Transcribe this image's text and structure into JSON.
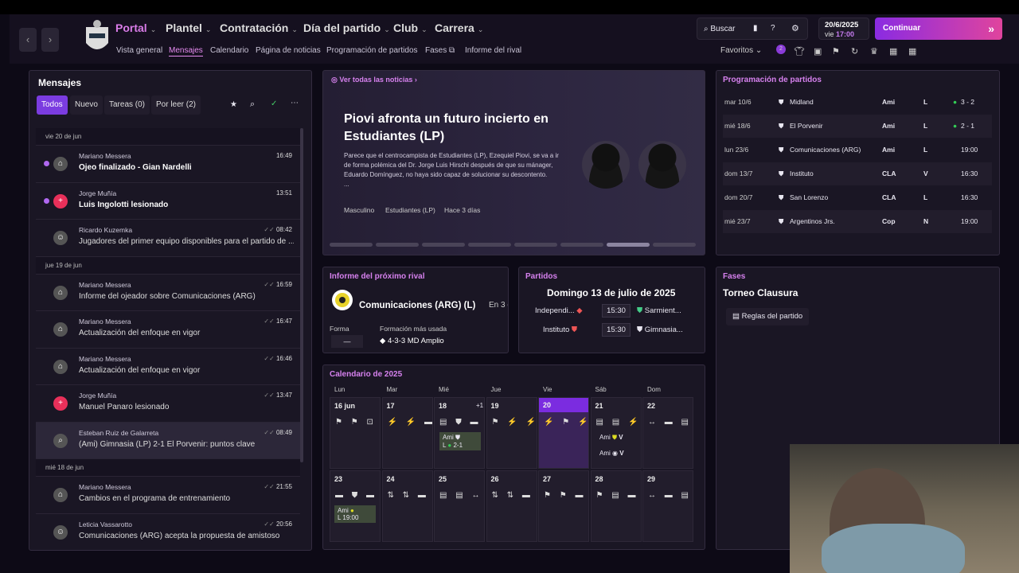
{
  "nav": {
    "main": [
      "Portal",
      "Plantel",
      "Contratación",
      "Día del partido",
      "Club",
      "Carrera"
    ],
    "sub": [
      "Vista general",
      "Mensajes",
      "Calendario",
      "Página de noticias",
      "Programación de partidos",
      "Fases",
      "Informe del rival"
    ],
    "search": "Buscar",
    "date": "20/6/2025",
    "day": "vie",
    "time": "17:00",
    "continue": "Continuar",
    "favorites": "Favoritos",
    "fav_badge": "2"
  },
  "messages": {
    "title": "Mensajes",
    "tabs": [
      "Todos",
      "Nuevo",
      "Tareas (0)",
      "Por leer (2)"
    ],
    "groups": [
      {
        "date": "vie 20 de jun",
        "items": [
          {
            "from": "Mariano Messera",
            "subject": "Ojeo finalizado - Gian Nardelli",
            "time": "16:49",
            "unread": true,
            "icon": "briefcase-icon"
          },
          {
            "from": "Jorge Muñía",
            "subject": "Luis Ingolotti lesionado",
            "time": "13:51",
            "unread": true,
            "icon": "medical-icon"
          },
          {
            "from": "Ricardo Kuzemka",
            "subject": "Jugadores del primer equipo disponibles para el partido de ...",
            "time": "08:42",
            "unread": false,
            "icon": "group-icon"
          }
        ]
      },
      {
        "date": "jue 19 de jun",
        "items": [
          {
            "from": "Mariano Messera",
            "subject": "Informe del ojeador sobre Comunicaciones (ARG)",
            "time": "16:59",
            "unread": false,
            "icon": "briefcase-icon"
          },
          {
            "from": "Mariano Messera",
            "subject": "Actualización del enfoque en vigor",
            "time": "16:47",
            "unread": false,
            "icon": "briefcase-icon"
          },
          {
            "from": "Mariano Messera",
            "subject": "Actualización del enfoque en vigor",
            "time": "16:46",
            "unread": false,
            "icon": "briefcase-icon"
          },
          {
            "from": "Jorge Muñía",
            "subject": "Manuel Panaro lesionado",
            "time": "13:47",
            "unread": false,
            "icon": "medical-icon"
          },
          {
            "from": "Esteban Ruiz de Galarreta",
            "subject": "(Ami) Gimnasia (LP) 2-1 El Porvenir: puntos clave",
            "time": "08:49",
            "unread": false,
            "icon": "magnifier-icon"
          }
        ]
      },
      {
        "date": "mié 18 de jun",
        "items": [
          {
            "from": "Mariano Messera",
            "subject": "Cambios en el programa de entrenamiento",
            "time": "21:55",
            "unread": false,
            "icon": "briefcase-icon"
          },
          {
            "from": "Leticia Vassarotto",
            "subject": "Comunicaciones (ARG) acepta la propuesta de amistoso",
            "time": "20:56",
            "unread": false,
            "icon": "group-icon"
          }
        ]
      }
    ]
  },
  "news": {
    "link": "Ver todas las noticias",
    "headline": "Piovi afronta un futuro incierto en Estudiantes (LP)",
    "body": "Parece que el centrocampista de Estudiantes (LP), Ezequiel Piovi, se va a ir de forma polémica del Dr. Jorge Luis Hirschi después de que su mánager, Eduardo Domínguez, no haya sido capaz de solucionar su descontento.",
    "ellipsis": "...",
    "tags": [
      "Masculino",
      "Estudiantes (LP)",
      "Hace 3 días"
    ]
  },
  "fixtures": {
    "title": "Programación de partidos",
    "rows": [
      {
        "date": "mar 10/6",
        "team": "Midland",
        "comp": "Ami",
        "venue": "L",
        "result": "3 - 2",
        "win": true
      },
      {
        "date": "mié 18/6",
        "team": "El Porvenir",
        "comp": "Ami",
        "venue": "L",
        "result": "2 - 1",
        "win": true
      },
      {
        "date": "lun 23/6",
        "team": "Comunicaciones (ARG)",
        "comp": "Ami",
        "venue": "L",
        "result": "19:00",
        "win": false
      },
      {
        "date": "dom 13/7",
        "team": "Instituto",
        "comp": "CLA",
        "venue": "V",
        "result": "16:30",
        "win": false
      },
      {
        "date": "dom 20/7",
        "team": "San Lorenzo",
        "comp": "CLA",
        "venue": "L",
        "result": "16:30",
        "win": false
      },
      {
        "date": "mié 23/7",
        "team": "Argentinos Jrs.",
        "comp": "Cop",
        "venue": "N",
        "result": "19:00",
        "win": false
      }
    ]
  },
  "rival": {
    "title": "Informe del próximo rival",
    "team": "Comunicaciones (ARG) (L)",
    "extra": "En 3 d",
    "form_label": "Forma",
    "form": "—",
    "formation_label": "Formación más usada",
    "formation": "4-3-3 MD Amplio"
  },
  "matches": {
    "title": "Partidos",
    "date": "Domingo 13 de julio de 2025",
    "rows": [
      {
        "home": "Independi...",
        "time": "15:30",
        "away": "Sarmient..."
      },
      {
        "home": "Instituto",
        "time": "15:30",
        "away": "Gimnasia..."
      }
    ]
  },
  "phases": {
    "title": "Fases",
    "name": "Torneo Clausura",
    "rules": "Reglas del partido"
  },
  "calendar": {
    "title": "Calendario de 2025",
    "days": [
      "Lun",
      "Mar",
      "Mié",
      "Jue",
      "Vie",
      "Sáb",
      "Dom"
    ],
    "week1": [
      "16 jun",
      "17",
      "18",
      "19",
      "20",
      "21",
      "22"
    ],
    "week2": [
      "23",
      "24",
      "25",
      "26",
      "27",
      "28",
      "29"
    ],
    "plus": "+1",
    "ami": "Ami",
    "v": "V",
    "l": "L",
    "res": "2-1",
    "t": "19:00"
  }
}
